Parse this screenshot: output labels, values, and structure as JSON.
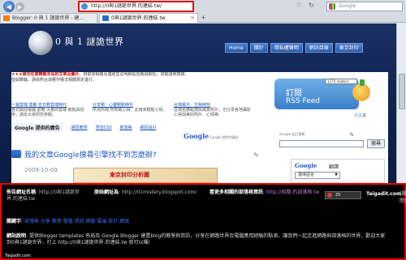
{
  "browser": {
    "url": "http://0與1謎詭世界.的連結.tw/",
    "search_placeholder": "Google",
    "tabs": [
      {
        "label": "Blogger: 0 與 1 謎詭世界 - 建..."
      },
      {
        "label": "0與1謎詭世界.的連結.tw"
      }
    ]
  },
  "site": {
    "title": "0 與 1 謎詭世界",
    "nav": [
      "Home",
      "關於",
      "隱私權聲明",
      "網站目錄",
      "東京封印"
    ]
  },
  "content": {
    "notice_highlight": "★★★請勿任意轉載本站的文章及圖片",
    "notice_text": "，目歡迎網路及連結並註明網站名稱與網址，如能讓我感謝。",
    "notice_text2": "但如轉載，請依照台灣著作權法相關規定進行，",
    "columns": [
      {
        "title": "一窺雲端 雲都 伍日數雲端時代",
        "desc": "各式網站電腦 前瞻 大量的雲端 觀點與技術，請去大家研究參觀。"
      },
      {
        "title": "分享類：心靈輕鬆時光",
        "desc": "所見所聞 所知或心得，此用來輕鬆心情。"
      },
      {
        "title": "台灣風光．忘我時刻",
        "desc": "台灣名勝點滴與風景照片，也分享各地攝影心得與美好照片、心情等。"
      }
    ],
    "ad_bar": {
      "first": "Google 提供的廣告",
      "links": [
        "網頁教學",
        "學習CSS",
        "部落格",
        "網頁設計"
      ]
    },
    "google_label": "Google 提供的廣告",
    "feed": {
      "label1": "訂閱",
      "label2": "RSS Feed",
      "counter": "1270 readers",
      "subscribe": "小工具"
    },
    "gsearch_button": "搜尋",
    "gsearch_logo": "Google 自訂搜尋",
    "post": {
      "title": "我的文章Google搜尋引擎找不到怎麼辦?",
      "date": "2009-10-09",
      "banner": "東京封印分析圖"
    },
    "translate": {
      "google": "Google",
      "label": "翻譯",
      "select": "選擇語言"
    }
  },
  "overlay": {
    "title_label": "佈告網址名稱",
    "title_value": "http://0與1謎詭世界.的連結.tw",
    "orig_label": "原始網址為",
    "orig_value": "http://01mistery.blogspot.com/",
    "more_label": "看更多相關的部落格資訊",
    "more_value": "http://相關.的部落格.tw",
    "rating": "25",
    "taigadit": "Taigadit.com",
    "flag": "[關閉]",
    "keyword_label": "關鍵字",
    "keyword_value": "部落格 分享 教學 電腦 資訊 網路 雲端 設計 網頁",
    "desc_label": "網站說明",
    "desc_value": "提供Blogger templates 佈局及 Google Blogger 建置blog的教學與資訊，分享在網路世界及電腦應用經驗的點滴，讓我們一起走進網路與部落格的世界，歡迎大家到0與1謎詭世界，打上 http://0與1謎詭世界.的連結.tw 就可以囉!",
    "footer": "Taigadit.com"
  }
}
